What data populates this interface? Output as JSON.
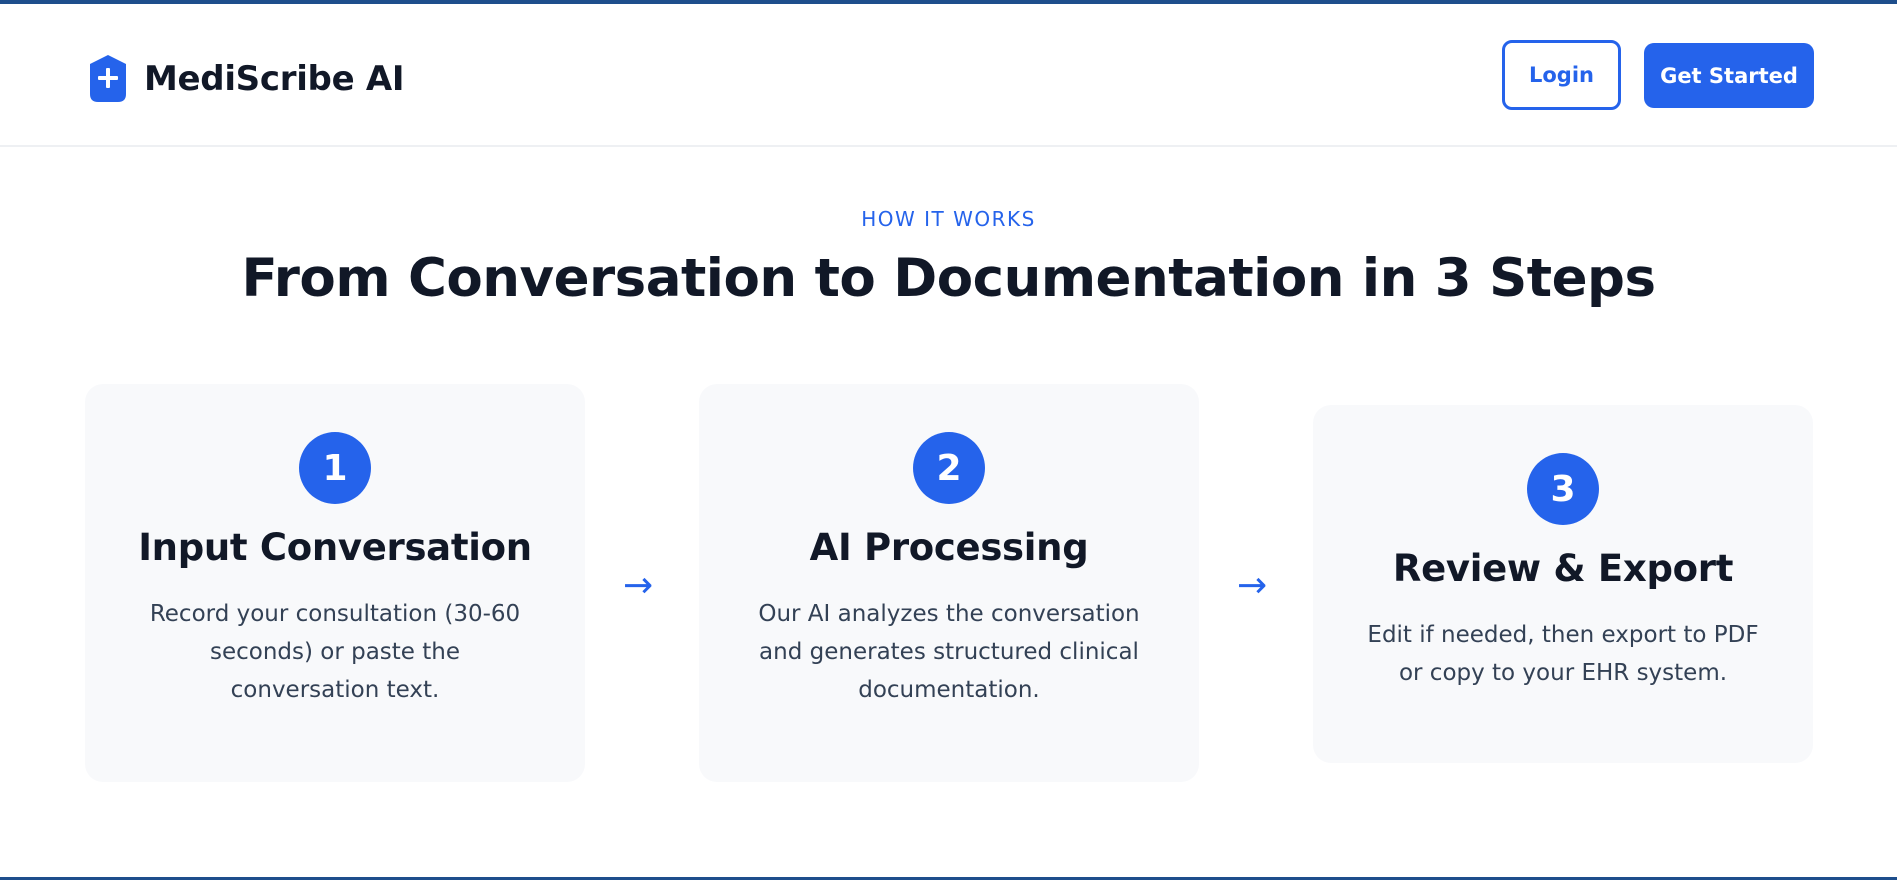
{
  "colors": {
    "accent": "#2563eb",
    "heading": "#111827",
    "body_text": "#334155",
    "card_bg": "#f8f9fb",
    "top_bar": "#1e4e8c"
  },
  "header": {
    "logo_icon": "shield-plus-icon",
    "brand_name": "MediScribe AI",
    "login_label": "Login",
    "get_started_label": "Get Started"
  },
  "how_it_works": {
    "eyebrow": "HOW IT WORKS",
    "title": "From Conversation to Documentation in 3 Steps",
    "arrow_glyph": "→",
    "steps": [
      {
        "number": "1",
        "title": "Input Conversation",
        "description": "Record your consultation (30-60 seconds) or paste the conversation text."
      },
      {
        "number": "2",
        "title": "AI Processing",
        "description": "Our AI analyzes the conversation and generates structured clinical documentation."
      },
      {
        "number": "3",
        "title": "Review & Export",
        "description": "Edit if needed, then export to PDF or copy to your EHR system."
      }
    ]
  }
}
